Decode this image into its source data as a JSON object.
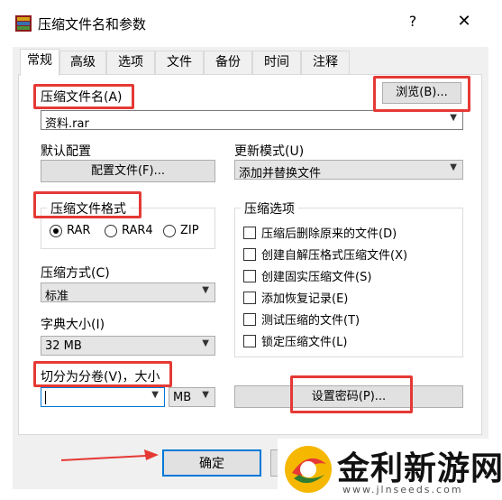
{
  "window": {
    "title": "压缩文件名和参数",
    "help_glyph": "?",
    "close_glyph": "✕"
  },
  "tabs": [
    "常规",
    "高级",
    "选项",
    "文件",
    "备份",
    "时间",
    "注释"
  ],
  "archive_name": {
    "label": "压缩文件名(A)",
    "value": "资料.rar",
    "browse_button": "浏览(B)..."
  },
  "profile": {
    "label": "默认配置",
    "button": "配置文件(F)..."
  },
  "update_mode": {
    "label": "更新模式(U)",
    "value": "添加并替换文件"
  },
  "format": {
    "label": "压缩文件格式",
    "options": [
      "RAR",
      "RAR4",
      "ZIP"
    ],
    "selected": "RAR"
  },
  "method": {
    "label": "压缩方式(C)",
    "value": "标准"
  },
  "dictionary": {
    "label": "字典大小(I)",
    "value": "32 MB"
  },
  "split": {
    "label": "切分为分卷(V)，大小",
    "value": "",
    "unit": "MB"
  },
  "options": {
    "label": "压缩选项",
    "items": [
      "压缩后删除原来的文件(D)",
      "创建自解压格式压缩文件(X)",
      "创建固实压缩文件(S)",
      "添加恢复记录(E)",
      "测试压缩的文件(T)",
      "锁定压缩文件(L)"
    ]
  },
  "password_button": "设置密码(P)...",
  "ok_button": "确定",
  "watermark": {
    "brand": "金利新游网",
    "url": "www.jlnseeds.com"
  },
  "colors": {
    "highlight": "#e53935",
    "dialog_bg": "#f0f0f0",
    "button_bg": "#e1e1e1"
  }
}
